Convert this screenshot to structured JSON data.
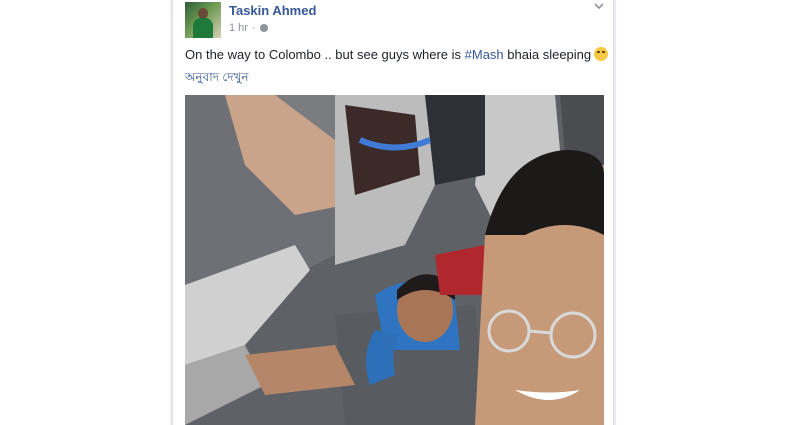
{
  "post": {
    "author": "Taskin Ahmed",
    "time": "1 hr",
    "dot": "·",
    "privacy_icon": "globe-icon",
    "text_before": "On the way to Colombo .. but see guys where is ",
    "hashtag": "#Mash",
    "text_after": " bhaia sleeping",
    "emoji": "winking-tongue-emoji",
    "translate_link": "অনুবাদ দেখুন"
  },
  "colors": {
    "link": "#365899",
    "meta": "#90949c",
    "text": "#1d2129",
    "page_bg": "#e9ebee"
  }
}
